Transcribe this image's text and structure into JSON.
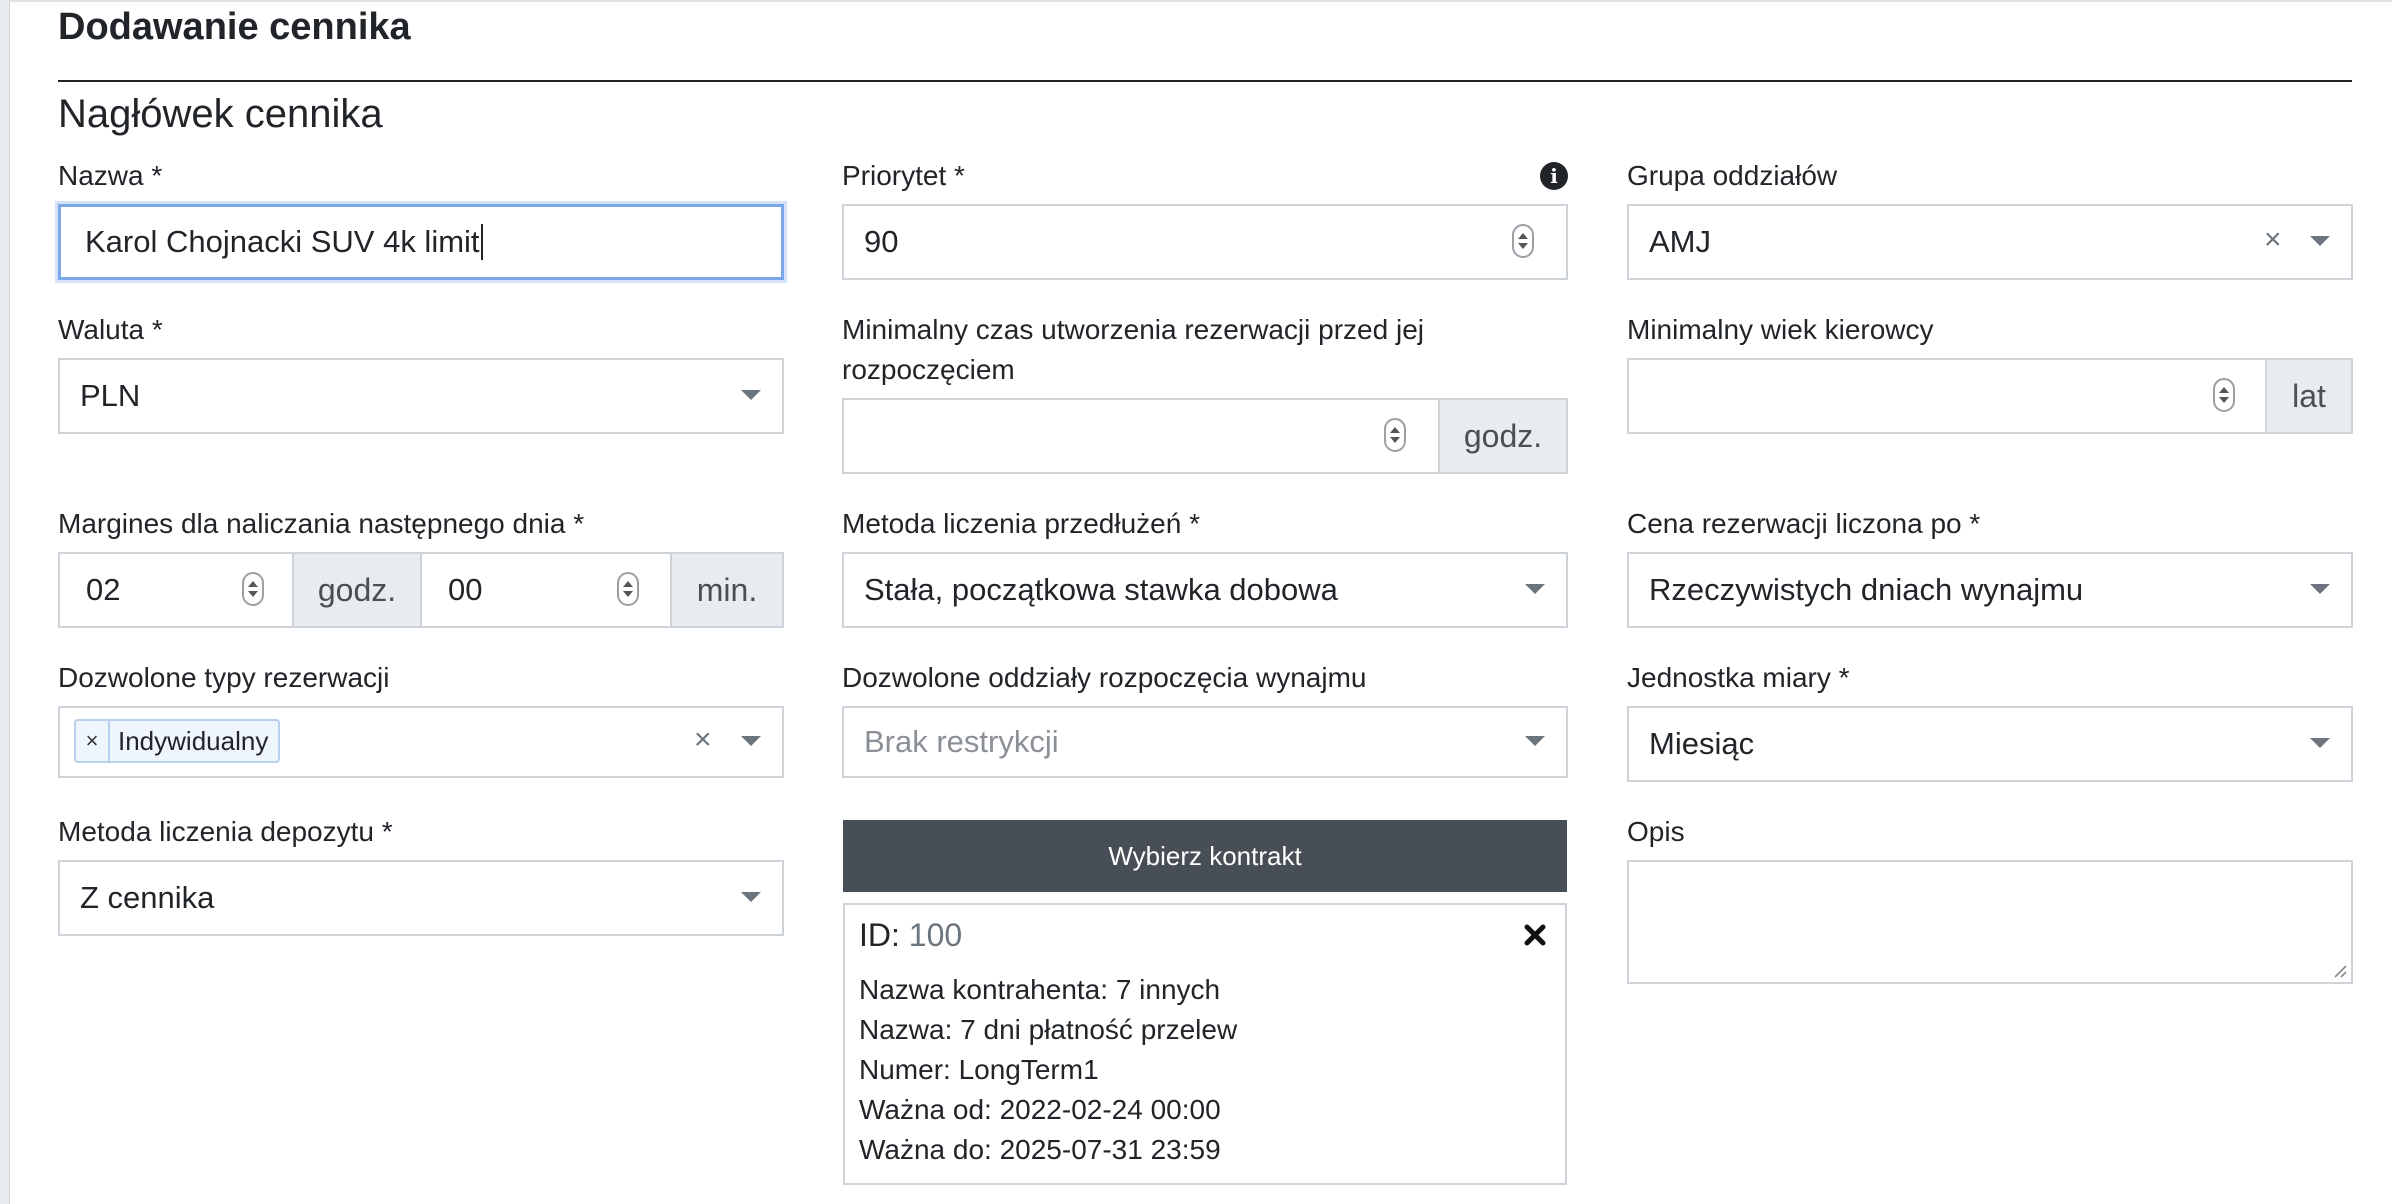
{
  "page": {
    "title": "Dodawanie cennika",
    "section_title": "Nagłówek cennika"
  },
  "form": {
    "nazwa": {
      "label": "Nazwa *",
      "value": "Karol Chojnacki SUV 4k limit"
    },
    "priorytet": {
      "label": "Priorytet *",
      "value": "90",
      "info_icon": "info-circle-icon"
    },
    "grupa_oddzialow": {
      "label": "Grupa oddziałów",
      "value": "AMJ",
      "clear": "×"
    },
    "waluta": {
      "label": "Waluta *",
      "value": "PLN"
    },
    "min_czas": {
      "label_line1": "Minimalny czas utworzenia rezerwacji przed jej",
      "label_line2": "rozpoczęciem",
      "value": "",
      "unit": "godz."
    },
    "min_wiek": {
      "label": "Minimalny wiek kierowcy",
      "value": "",
      "unit": "lat"
    },
    "margines": {
      "label": "Margines dla naliczania następnego dnia *",
      "hours": "02",
      "hours_unit": "godz.",
      "minutes": "00",
      "minutes_unit": "min."
    },
    "metoda_przedluzen": {
      "label": "Metoda liczenia przedłużeń *",
      "value": "Stała, początkowa stawka dobowa"
    },
    "cena_rezerwacji": {
      "label": "Cena rezerwacji liczona po *",
      "value": "Rzeczywistych dniach wynajmu"
    },
    "typy_rezerwacji": {
      "label": "Dozwolone typy rezerwacji",
      "tags": [
        "Indywidualny"
      ],
      "tag_remove": "×",
      "clear": "×"
    },
    "oddzialy": {
      "label": "Dozwolone oddziały rozpoczęcia wynajmu",
      "placeholder": "Brak restrykcji"
    },
    "jednostka": {
      "label": "Jednostka miary *",
      "value": "Miesiąc"
    },
    "metoda_depozytu": {
      "label": "Metoda liczenia depozytu *",
      "value": "Z cennika"
    },
    "kontrakt": {
      "button_label": "Wybierz kontrakt",
      "id_label": "ID: ",
      "id_value": "100",
      "lines": [
        "Nazwa kontrahenta: 7 innych",
        "Nazwa: 7 dni płatność przelew",
        "Numer: LongTerm1",
        "Ważna od: 2022-02-24 00:00",
        "Ważna do: 2025-07-31 23:59"
      ]
    },
    "opis": {
      "label": "Opis",
      "value": ""
    }
  }
}
